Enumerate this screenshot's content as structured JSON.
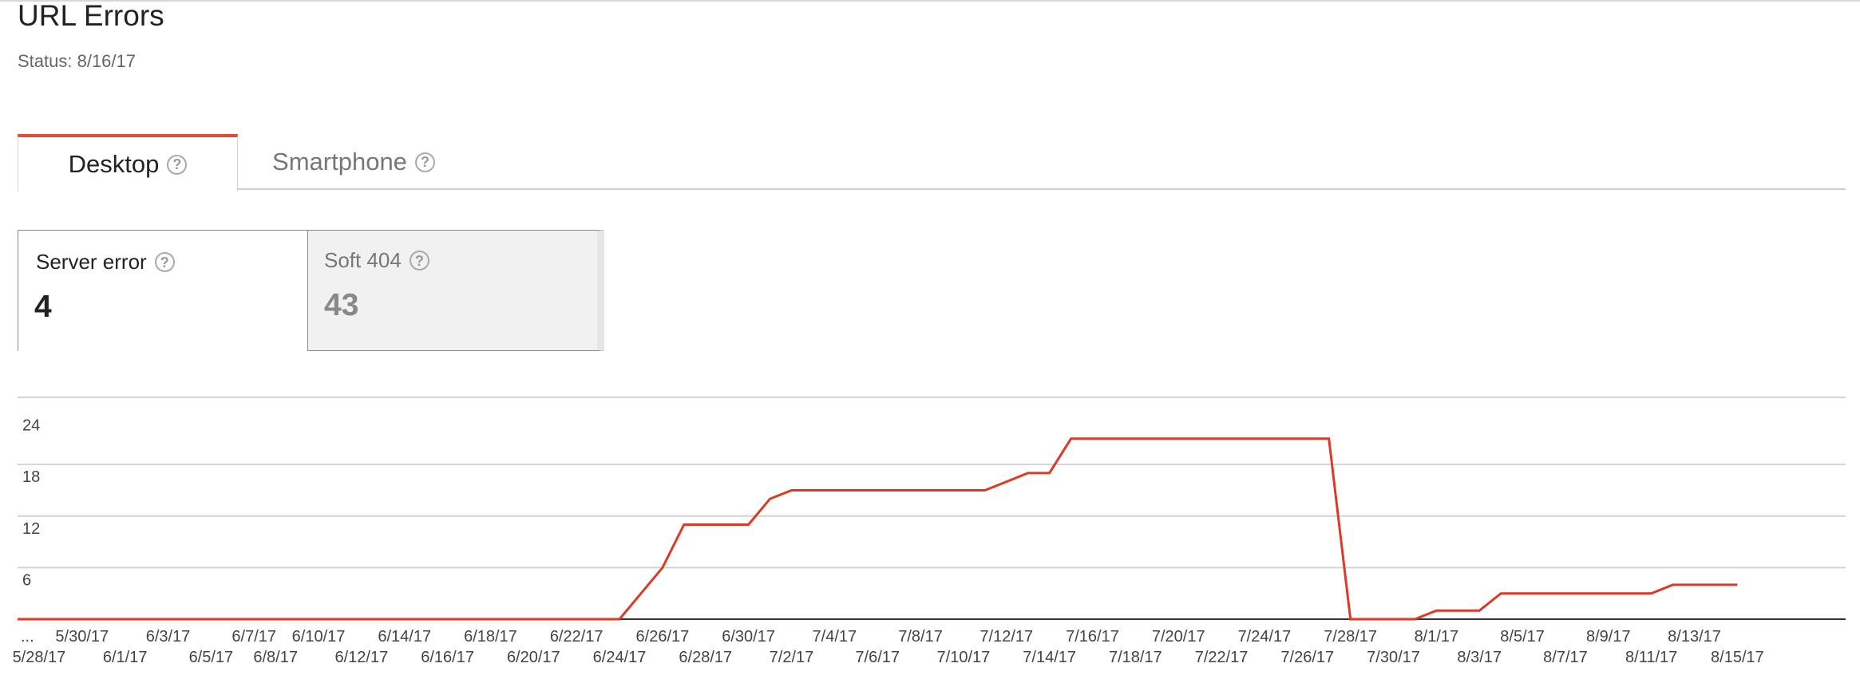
{
  "page": {
    "title": "URL Errors",
    "status": "Status: 8/16/17"
  },
  "tabs": [
    {
      "label": "Desktop",
      "active": true
    },
    {
      "label": "Smartphone",
      "active": false
    }
  ],
  "metrics": [
    {
      "label": "Server error",
      "value": "4",
      "selected": true
    },
    {
      "label": "Soft 404",
      "value": "43",
      "selected": false
    }
  ],
  "icons": {
    "help": "help-icon"
  },
  "colors": {
    "accent": "#dd4b39",
    "line": "#dd3a26"
  },
  "chart_data": {
    "type": "line",
    "title": "",
    "xlabel": "",
    "ylabel": "",
    "ylim": [
      0,
      26
    ],
    "yticks": [
      6,
      12,
      18,
      24
    ],
    "grid": true,
    "leading_label": "...",
    "x_tick_labels": [
      "5/28/17",
      "5/30/17",
      "6/1/17",
      "6/3/17",
      "6/5/17",
      "6/7/17",
      "6/8/17",
      "6/10/17",
      "6/12/17",
      "6/14/17",
      "6/16/17",
      "6/18/17",
      "6/20/17",
      "6/22/17",
      "6/24/17",
      "6/26/17",
      "6/28/17",
      "6/30/17",
      "7/2/17",
      "7/4/17",
      "7/6/17",
      "7/8/17",
      "7/10/17",
      "7/12/17",
      "7/14/17",
      "7/16/17",
      "7/18/17",
      "7/20/17",
      "7/22/17",
      "7/24/17",
      "7/26/17",
      "7/28/17",
      "7/30/17",
      "8/1/17",
      "8/3/17",
      "8/5/17",
      "8/7/17",
      "8/9/17",
      "8/11/17",
      "8/13/17",
      "8/15/17"
    ],
    "series": [
      {
        "points": [
          [
            "5/27/17",
            0
          ],
          [
            "6/24/17",
            0
          ],
          [
            "6/26/17",
            6
          ],
          [
            "6/27/17",
            11
          ],
          [
            "6/30/17",
            11
          ],
          [
            "7/1/17",
            14
          ],
          [
            "7/2/17",
            15
          ],
          [
            "7/11/17",
            15
          ],
          [
            "7/13/17",
            17
          ],
          [
            "7/14/17",
            17
          ],
          [
            "7/15/17",
            21
          ],
          [
            "7/27/17",
            21
          ],
          [
            "7/28/17",
            0
          ],
          [
            "7/31/17",
            0
          ],
          [
            "8/1/17",
            1
          ],
          [
            "8/3/17",
            1
          ],
          [
            "8/4/17",
            3
          ],
          [
            "8/11/17",
            3
          ],
          [
            "8/12/17",
            4
          ],
          [
            "8/15/17",
            4
          ]
        ]
      }
    ]
  }
}
